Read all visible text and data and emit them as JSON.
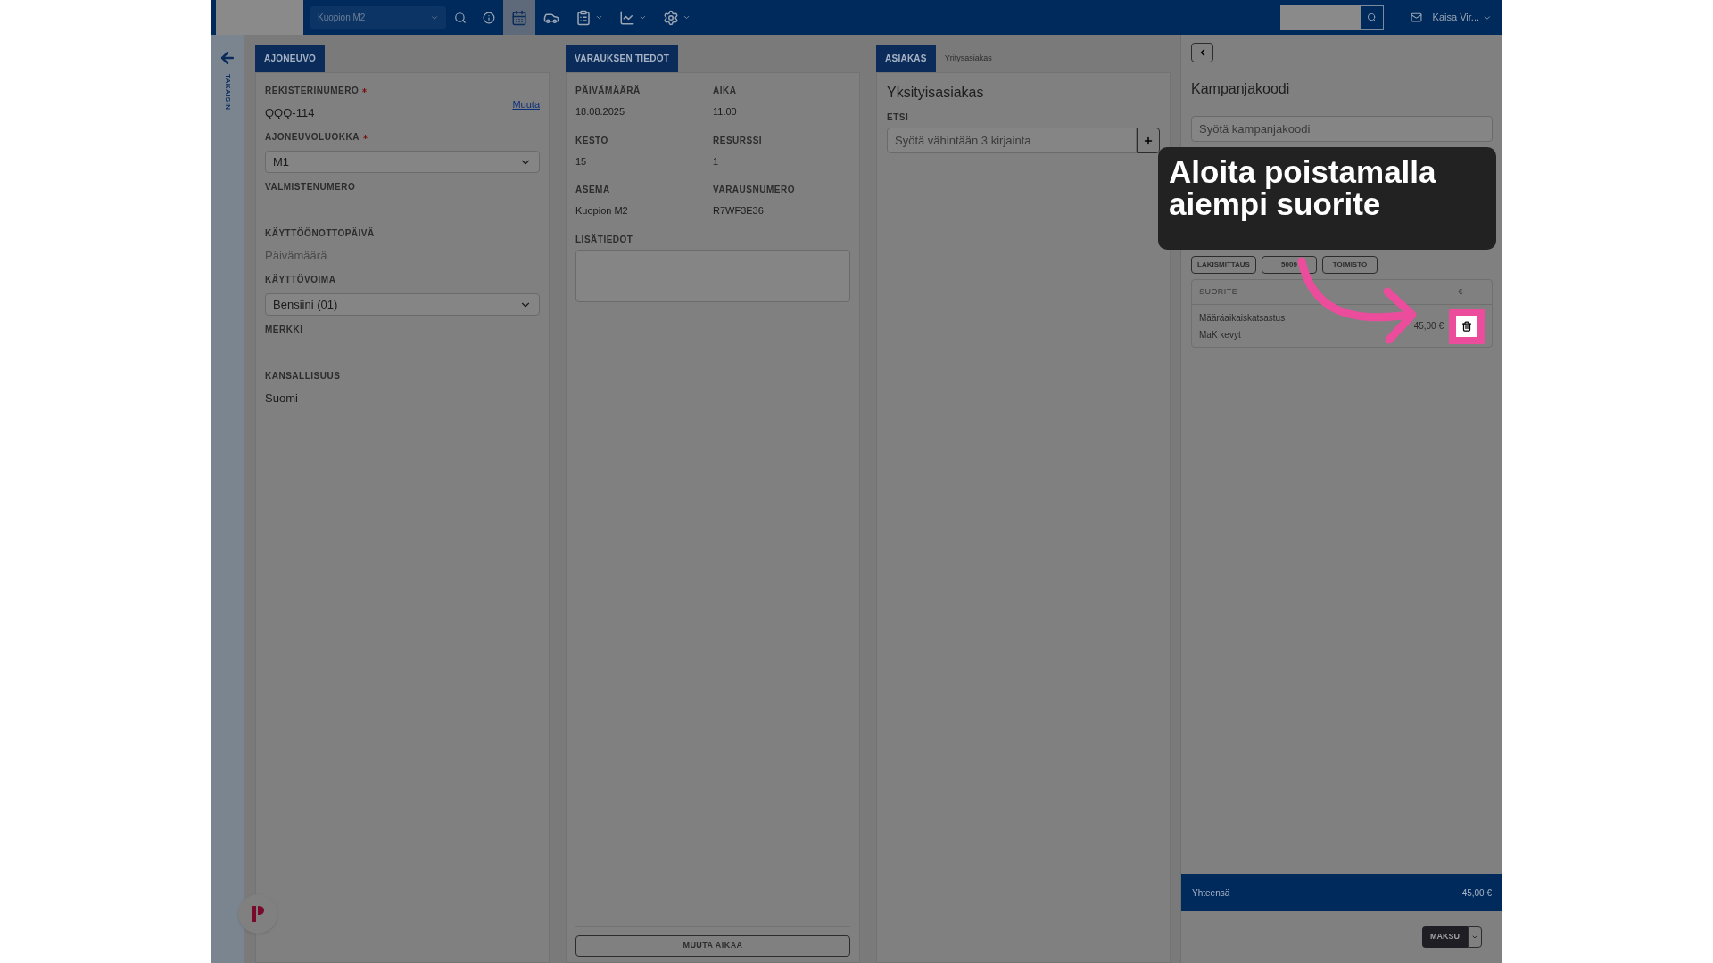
{
  "topbar": {
    "location": "Kuopion M2",
    "nav": [
      {
        "kind": "search",
        "selected": false,
        "dropdown": false
      },
      {
        "kind": "info",
        "selected": false,
        "dropdown": false
      },
      {
        "kind": "calendar",
        "selected": true,
        "dropdown": false
      },
      {
        "kind": "car",
        "selected": false,
        "dropdown": false
      },
      {
        "kind": "clipboard",
        "selected": false,
        "dropdown": true
      },
      {
        "kind": "chart",
        "selected": false,
        "dropdown": true
      },
      {
        "kind": "settings",
        "selected": false,
        "dropdown": true
      }
    ],
    "user": "Kaisa Vir..."
  },
  "sidebar": {
    "back_label": "TAKAISIN"
  },
  "vehicle": {
    "tab": "AJONEUVO",
    "fields": [
      {
        "kind": "text",
        "label": "REKISTERINUMERO",
        "required": true,
        "value": "QQQ-114",
        "link": "Muuta"
      },
      {
        "kind": "select",
        "label": "AJONEUVOLUOKKA",
        "required": true,
        "value": "M1"
      },
      {
        "kind": "text",
        "label": "VALMISTENUMERO",
        "required": false
      },
      {
        "kind": "date",
        "label": "KÄYTTÖÖNOTTOPÄIVÄ",
        "required": false,
        "placeholder": "Päivämäärä"
      },
      {
        "kind": "select",
        "label": "KÄYTTÖVOIMA",
        "required": false,
        "value": "Bensiini (01)"
      },
      {
        "kind": "text",
        "label": "MERKKI",
        "required": false
      },
      {
        "kind": "text",
        "label": "KANSALLISUUS",
        "required": false,
        "value": "Suomi"
      }
    ]
  },
  "booking": {
    "tab": "VARAUKSEN TIEDOT",
    "fields": [
      {
        "label": "PÄIVÄMÄÄRÄ",
        "value": "18.08.2025"
      },
      {
        "label": "AIKA",
        "value": "11.00"
      },
      {
        "label": "KESTO",
        "value": "15"
      },
      {
        "label": "RESURSSI",
        "value": "1"
      },
      {
        "label": "ASEMA",
        "value": "Kuopion M2"
      },
      {
        "label": "VARAUSNUMERO",
        "value": "R7WF3E36"
      }
    ],
    "notes_label": "LISÄTIEDOT",
    "button": "MUUTA AIKAA"
  },
  "customer": {
    "tabs": [
      {
        "label": "ASIAKAS",
        "selected": true
      },
      {
        "label": "Yritysasiakas",
        "selected": false
      }
    ],
    "title": "Yksityisasiakas",
    "search_label": "ETSI",
    "search_placeholder": "Syötä vähintään 3 kirjainta"
  },
  "cart": {
    "title": "Kampanjakoodi",
    "code_placeholder": "Syötä kampanjakoodi",
    "quick_buttons": [
      "LAKISMITTAUS",
      "5009",
      "TOIMISTO"
    ],
    "table": {
      "columns": [
        "SUORITE",
        "€"
      ],
      "rows": [
        {
          "name": "Määräaikaiskatsastus",
          "detail": "MaK kevyt",
          "price": "45,00 €"
        }
      ]
    },
    "total_label": "Yhteensä",
    "total": "45,00 €",
    "pay_button": "MAKSU"
  },
  "tooltip": {
    "text": "Aloita poistamalla aiempi suorite"
  }
}
